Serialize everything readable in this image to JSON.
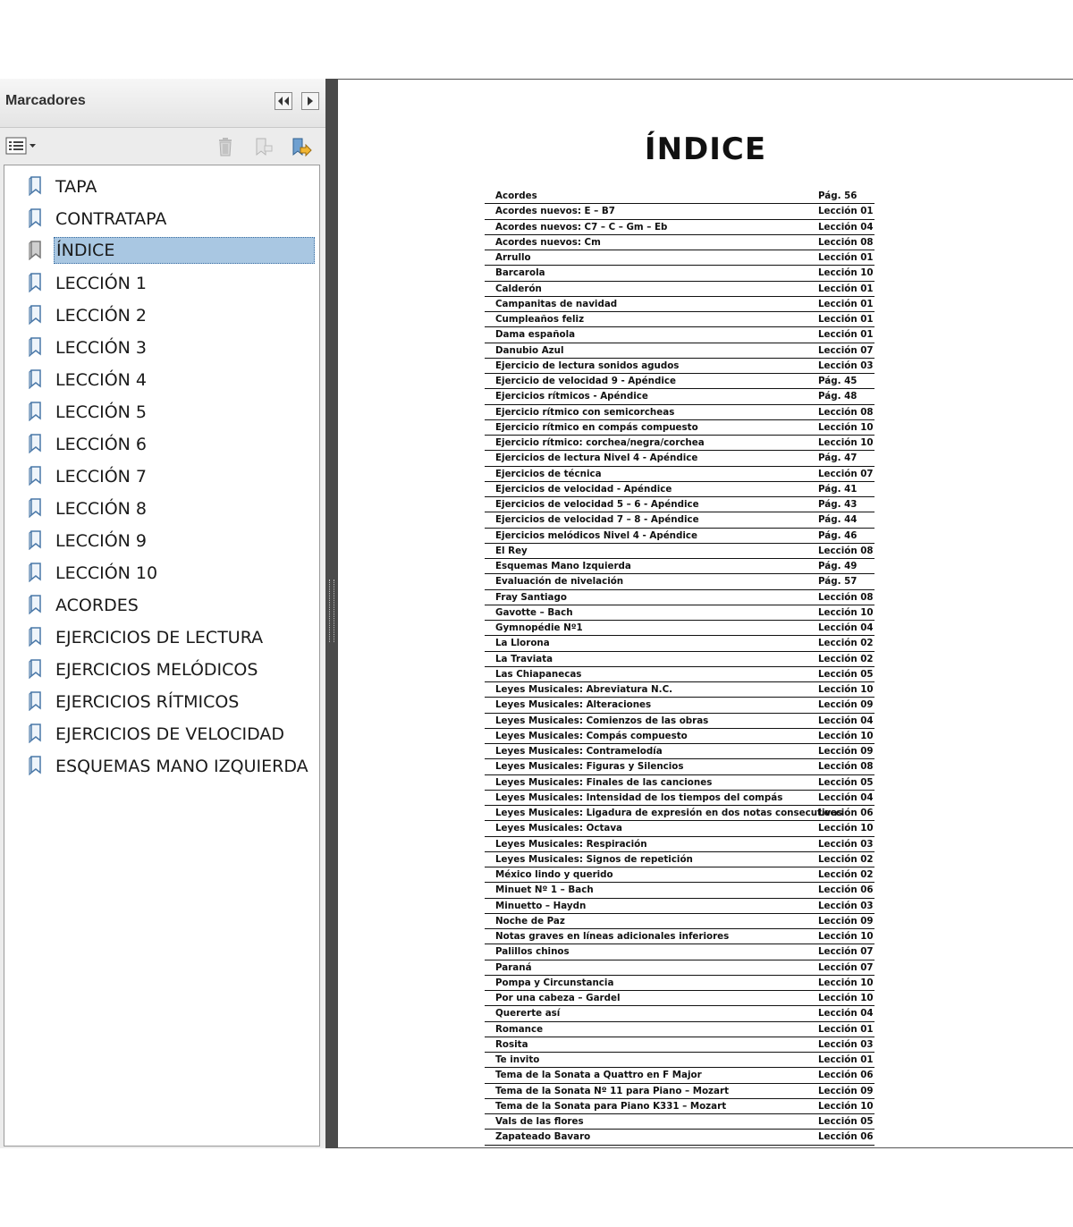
{
  "panel": {
    "title": "Marcadores"
  },
  "bookmarks": [
    {
      "label": "TAPA"
    },
    {
      "label": "CONTRATAPA"
    },
    {
      "label": "ÍNDICE",
      "selected": true
    },
    {
      "label": "LECCIÓN 1"
    },
    {
      "label": "LECCIÓN 2"
    },
    {
      "label": "LECCIÓN 3"
    },
    {
      "label": "LECCIÓN 4"
    },
    {
      "label": "LECCIÓN 5"
    },
    {
      "label": "LECCIÓN 6"
    },
    {
      "label": "LECCIÓN 7"
    },
    {
      "label": "LECCIÓN 8"
    },
    {
      "label": "LECCIÓN 9"
    },
    {
      "label": "LECCIÓN 10"
    },
    {
      "label": "ACORDES"
    },
    {
      "label": "EJERCICIOS DE LECTURA"
    },
    {
      "label": "EJERCICIOS MELÓDICOS"
    },
    {
      "label": "EJERCICIOS RÍTMICOS"
    },
    {
      "label": "EJERCICIOS DE VELOCIDAD"
    },
    {
      "label": "ESQUEMAS MANO IZQUIERDA"
    }
  ],
  "document": {
    "title": "ÍNDICE",
    "entries": [
      {
        "title": "Acordes",
        "page": "Pág. 56"
      },
      {
        "title": "Acordes nuevos:  E – B7",
        "page": "Lección 01"
      },
      {
        "title": "Acordes nuevos: C7 – C – Gm – Eb",
        "page": "Lección 04"
      },
      {
        "title": "Acordes nuevos: Cm",
        "page": "Lección 08"
      },
      {
        "title": "Arrullo",
        "page": "Lección 01"
      },
      {
        "title": "Barcarola",
        "page": "Lección 10"
      },
      {
        "title": "Calderón",
        "page": "Lección 01"
      },
      {
        "title": "Campanitas de navidad",
        "page": "Lección 01"
      },
      {
        "title": "Cumpleaños feliz",
        "page": "Lección 01"
      },
      {
        "title": "Dama española",
        "page": "Lección 01"
      },
      {
        "title": "Danubio Azul",
        "page": "Lección 07"
      },
      {
        "title": "Ejercicio de lectura sonidos agudos",
        "page": "Lección 03"
      },
      {
        "title": "Ejercicio de velocidad 9 - Apéndice",
        "page": "Pág. 45"
      },
      {
        "title": "Ejercicios rítmicos - Apéndice",
        "page": "Pág. 48"
      },
      {
        "title": "Ejercicio rítmico con semicorcheas",
        "page": "Lección 08"
      },
      {
        "title": "Ejercicio rítmico en compás compuesto",
        "page": "Lección 10"
      },
      {
        "title": "Ejercicio rítmico: corchea/negra/corchea",
        "page": "Lección 10"
      },
      {
        "title": "Ejercicios de lectura Nivel 4 - Apéndice",
        "page": "Pág. 47"
      },
      {
        "title": "Ejercicios de técnica",
        "page": "Lección 07"
      },
      {
        "title": "Ejercicios de velocidad - Apéndice",
        "page": "Pág. 41"
      },
      {
        "title": "Ejercicios de velocidad 5 – 6 - Apéndice",
        "page": "Pág. 43"
      },
      {
        "title": "Ejercicios de velocidad 7 – 8 - Apéndice",
        "page": "Pág. 44"
      },
      {
        "title": "Ejercicios melódicos Nivel 4 - Apéndice",
        "page": "Pág. 46"
      },
      {
        "title": "El Rey",
        "page": "Lección 08"
      },
      {
        "title": "Esquemas Mano Izquierda",
        "page": "Pág. 49"
      },
      {
        "title": "Evaluación de nivelación",
        "page": "Pág. 57"
      },
      {
        "title": "Fray Santiago",
        "page": "Lección 08"
      },
      {
        "title": "Gavotte – Bach",
        "page": "Lección 10"
      },
      {
        "title": "Gymnopédie Nº1",
        "page": "Lección 04"
      },
      {
        "title": "La Llorona",
        "page": "Lección 02"
      },
      {
        "title": "La Traviata",
        "page": "Lección 02"
      },
      {
        "title": "Las Chiapanecas",
        "page": "Lección 05"
      },
      {
        "title": "Leyes Musicales: Abreviatura N.C.",
        "page": "Lección 10"
      },
      {
        "title": "Leyes Musicales: Alteraciones",
        "page": "Lección 09"
      },
      {
        "title": "Leyes Musicales: Comienzos de las obras",
        "page": "Lección 04"
      },
      {
        "title": "Leyes Musicales: Compás compuesto",
        "page": "Lección 10"
      },
      {
        "title": "Leyes Musicales: Contramelodía",
        "page": "Lección 09"
      },
      {
        "title": "Leyes Musicales: Figuras y Silencios",
        "page": "Lección 08"
      },
      {
        "title": "Leyes Musicales: Finales de las canciones",
        "page": "Lección 05"
      },
      {
        "title": "Leyes Musicales: Intensidad de los tiempos del compás",
        "page": "Lección 04"
      },
      {
        "title": "Leyes Musicales: Ligadura de expresión en dos notas consecutivas",
        "page": "Lección 06"
      },
      {
        "title": "Leyes Musicales: Octava",
        "page": "Lección 10"
      },
      {
        "title": "Leyes Musicales: Respiración",
        "page": "Lección 03"
      },
      {
        "title": "Leyes Musicales: Signos de repetición",
        "page": "Lección 02"
      },
      {
        "title": "México lindo y querido",
        "page": "Lección 02"
      },
      {
        "title": "Minuet Nº 1 – Bach",
        "page": "Lección 06"
      },
      {
        "title": "Minuetto – Haydn",
        "page": "Lección 03"
      },
      {
        "title": "Noche de Paz",
        "page": "Lección 09"
      },
      {
        "title": "Notas graves en líneas adicionales inferiores",
        "page": "Lección 10"
      },
      {
        "title": "Palillos chinos",
        "page": "Lección 07"
      },
      {
        "title": "Paraná",
        "page": "Lección 07"
      },
      {
        "title": "Pompa y Circunstancia",
        "page": "Lección 10"
      },
      {
        "title": "Por una cabeza – Gardel",
        "page": "Lección 10"
      },
      {
        "title": "Quererte así",
        "page": "Lección 04"
      },
      {
        "title": "Romance",
        "page": "Lección 01"
      },
      {
        "title": "Rosita",
        "page": "Lección 03"
      },
      {
        "title": "Te invito",
        "page": "Lección 01"
      },
      {
        "title": "Tema de la Sonata a Quattro en F Major",
        "page": "Lección 06"
      },
      {
        "title": "Tema de la Sonata Nº 11 para Piano – Mozart",
        "page": "Lección 09"
      },
      {
        "title": "Tema de la Sonata para Piano K331 – Mozart",
        "page": "Lección 10"
      },
      {
        "title": "Vals de las flores",
        "page": "Lección 05"
      },
      {
        "title": "Zapateado Bavaro",
        "page": "Lección 06"
      }
    ]
  },
  "icons": {
    "collapse": "double-left-arrow-icon",
    "expand": "right-arrow-icon",
    "options": "list-options-icon",
    "delete": "trash-icon",
    "new_bookmark": "bookmark-new-icon",
    "find_bookmark": "bookmark-find-icon",
    "bookmark": "bookmark-icon"
  },
  "colors": {
    "selection": "#a9c7e2",
    "splitter": "#4a4a4a"
  }
}
